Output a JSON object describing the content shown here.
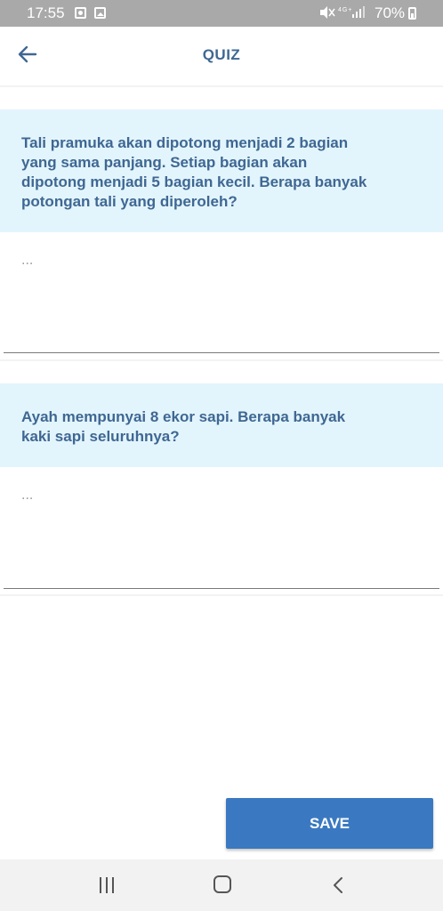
{
  "status_bar": {
    "time": "17:55",
    "network_icons": "🔇 4G+ .││",
    "battery": "70%"
  },
  "header": {
    "title": "QUIZ",
    "back_icon": "arrow-left-icon"
  },
  "questions": [
    {
      "text": "Tali pramuka akan dipotong menjadi 2 bagian yang sama panjang. Setiap bagian akan dipotong menjadi 5 bagian kecil. Berapa banyak potongan tali yang diperoleh?",
      "answer_placeholder": "...",
      "answer_value": ""
    },
    {
      "text": "Ayah mempunyai 8 ekor sapi. Berapa banyak kaki sapi seluruhnya?",
      "answer_placeholder": "...",
      "answer_value": ""
    }
  ],
  "actions": {
    "save_label": "SAVE"
  },
  "nav_bar": {
    "recents_icon": "recents-icon",
    "home_icon": "home-icon",
    "back_icon": "back-icon"
  },
  "colors": {
    "status_bar_bg": "#a9a9a9",
    "accent_text": "#3f6793",
    "question_bg": "#e3f5fc",
    "save_button_bg": "#3a79c1",
    "nav_bar_bg": "#f2f2f2"
  }
}
